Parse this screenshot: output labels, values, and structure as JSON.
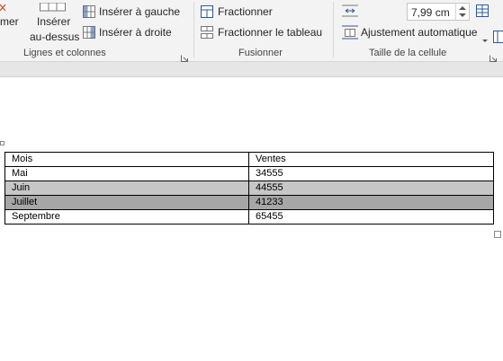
{
  "ribbon": {
    "rows_cols": {
      "truncated_label": "mer",
      "insert_above_line1": "Insérer",
      "insert_above_line2": "au-dessus",
      "insert_left": "Insérer à gauche",
      "insert_right": "Insérer à droite",
      "group_label": "Lignes et colonnes"
    },
    "merge": {
      "split_cells": "Fractionner",
      "split_table": "Fractionner le tableau",
      "group_label": "Fusionner"
    },
    "cell_size": {
      "width_value": "7,99 cm",
      "autofit": "Ajustement automatique",
      "group_label": "Taille de la cellule"
    }
  },
  "table": {
    "header": [
      "Mois",
      "Ventes"
    ],
    "rows": [
      {
        "cells": [
          "Mai",
          "34555"
        ],
        "highlight": "none"
      },
      {
        "cells": [
          "Juin",
          "44555"
        ],
        "highlight": "light-gray"
      },
      {
        "cells": [
          "Juillet",
          "41233"
        ],
        "highlight": "dark-gray"
      },
      {
        "cells": [
          "Septembre",
          "65455"
        ],
        "highlight": "none"
      }
    ]
  },
  "colors": {
    "ribbon_bg": "#f3f3f3",
    "highlight_light": "#c6c6c6",
    "highlight_dark": "#a6a6a6",
    "icon_blue": "#2b579a"
  }
}
